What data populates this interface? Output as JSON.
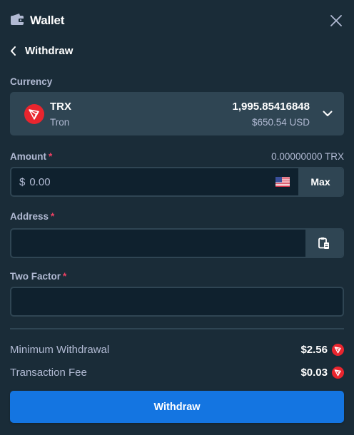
{
  "header": {
    "title": "Wallet",
    "icon": "wallet-icon",
    "close_icon": "close-icon"
  },
  "subheader": {
    "back_icon": "chevron-left-icon",
    "title": "Withdraw"
  },
  "currency": {
    "label": "Currency",
    "code": "TRX",
    "name": "Tron",
    "balance": "1,995.85416848",
    "usd_value": "$650.54 USD",
    "icon": "tron-icon",
    "dropdown_icon": "chevron-down-icon"
  },
  "amount": {
    "label": "Amount",
    "required_mark": "*",
    "crypto_value": "0.00000000 TRX",
    "prefix": "$",
    "placeholder": "0.00",
    "flag_icon": "us-flag-icon",
    "max_label": "Max"
  },
  "address": {
    "label": "Address",
    "required_mark": "*",
    "value": "",
    "paste_icon": "clipboard-paste-icon"
  },
  "two_factor": {
    "label": "Two Factor",
    "required_mark": "*",
    "value": ""
  },
  "info": {
    "min_withdrawal_label": "Minimum Withdrawal",
    "min_withdrawal_value": "$2.56",
    "fee_label": "Transaction Fee",
    "fee_value": "$0.03"
  },
  "withdraw_button": "Withdraw",
  "colors": {
    "background": "#1a2c38",
    "panel": "#2f4553",
    "input_bg": "#0f212e",
    "muted_text": "#b1bad3",
    "primary": "#1475e1",
    "required": "#ed4163",
    "tron_red": "#e9252e"
  }
}
